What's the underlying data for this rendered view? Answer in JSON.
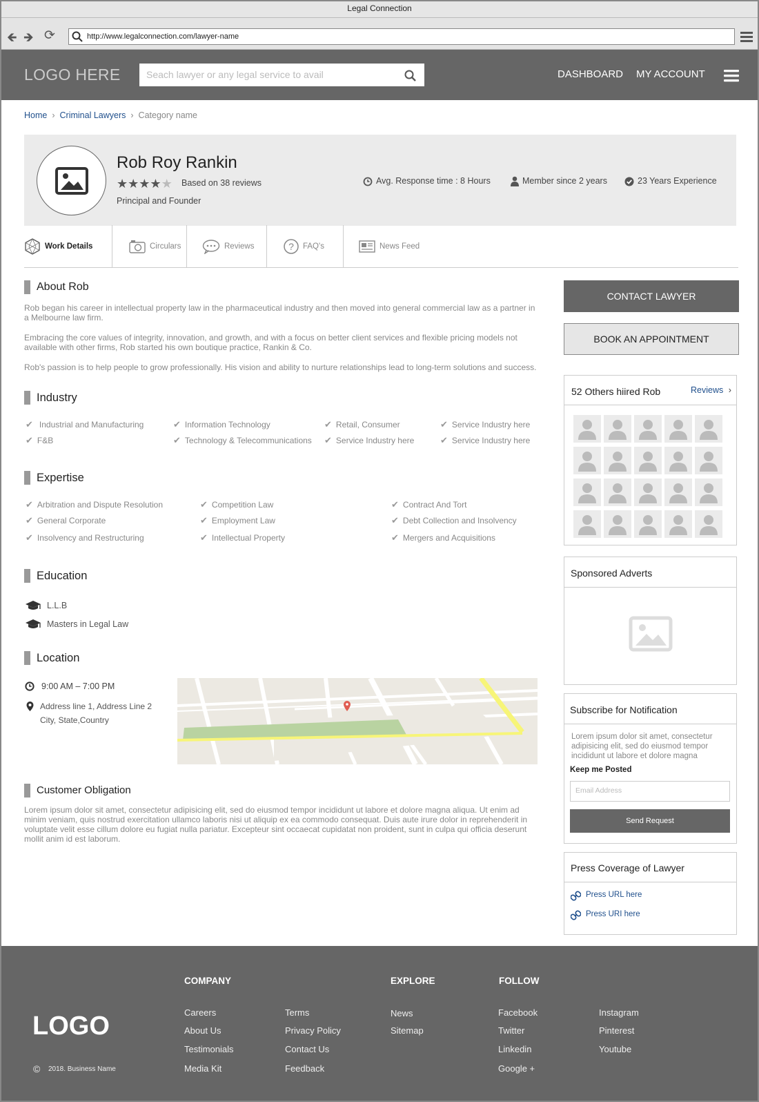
{
  "window": {
    "title": "Legal Connection",
    "url": "http://www.legalconnection.com/lawyer-name"
  },
  "header": {
    "logo": "LOGO HERE",
    "search_placeholder": "Seach lawyer or any legal service to avail",
    "nav": [
      "DASHBOARD",
      "MY ACCOUNT"
    ]
  },
  "breadcrumb": {
    "home": "Home",
    "category": "Criminal Lawyers",
    "current": "Category name"
  },
  "profile": {
    "name": "Rob Roy Rankin",
    "rating": 4,
    "rating_max": 5,
    "reviews_text": "Based on 38 reviews",
    "role": "Principal and Founder",
    "stats": {
      "response": "Avg. Response time : 8 Hours",
      "member": "Member since 2 years",
      "experience": "23 Years Experience"
    }
  },
  "tabs": [
    "Work Details",
    "Circulars",
    "Reviews",
    "FAQ's",
    "News Feed"
  ],
  "about": {
    "heading": "About Rob",
    "paragraphs": [
      "Rob began his career in intellectual property law in the pharmaceutical industry and then moved into general commercial law as a partner in a Melbourne law firm.",
      "Embracing the core values of integrity, innovation, and growth, and with a focus on better client services and flexible pricing models not available with other firms, Rob started his own boutique practice, Rankin & Co.",
      "Rob's passion is to help people to grow professionally. His vision and ability to nurture relationships lead to long-term solutions and success."
    ]
  },
  "industry": {
    "heading": "Industry",
    "items": [
      "Industrial and Manufacturing",
      "Information Technology",
      "Retail, Consumer",
      "Service Industry here",
      "F&B",
      "Technology & Telecommunications",
      "Service Industry here",
      "Service Industry here"
    ]
  },
  "expertise": {
    "heading": "Expertise",
    "items": [
      "Arbitration and Dispute Resolution",
      "Competition Law",
      "Contract And Tort",
      "General Corporate",
      "Employment Law",
      "Debt Collection and Insolvency",
      "Insolvency and Restructuring",
      "Intellectual Property",
      "Mergers and Acquisitions"
    ]
  },
  "education": {
    "heading": "Education",
    "items": [
      "L.L.B",
      "Masters in Legal Law"
    ]
  },
  "location": {
    "heading": "Location",
    "hours": "9:00 AM – 7:00 PM",
    "address1": "Address line 1, Address Line 2",
    "address2": "City, State,Country"
  },
  "obligation": {
    "heading": "Customer Obligation",
    "text": "Lorem ipsum dolor sit amet, consectetur adipisicing elit, sed do eiusmod tempor incididunt ut labore et dolore magna aliqua. Ut enim ad minim veniam, quis nostrud exercitation ullamco laboris nisi ut aliquip ex ea commodo consequat. Duis aute irure dolor in reprehenderit in voluptate velit esse cillum dolore eu fugiat nulla pariatur. Excepteur sint occaecat cupidatat non proident, sunt in culpa qui officia deserunt mollit anim id est laborum."
  },
  "sidebar": {
    "contact": "CONTACT LAWYER",
    "book": "BOOK AN APPOINTMENT",
    "hired": {
      "title": "52 Others hiired Rob",
      "link": "Reviews"
    },
    "sponsored": "Sponsored Adverts",
    "subscribe": {
      "title": "Subscribe for Notification",
      "text": "Lorem ipsum dolor sit amet, consectetur adipisicing elit, sed do eiusmod tempor incididunt ut labore et dolore magna",
      "label": "Keep me Posted",
      "placeholder": "Email Address",
      "button": "Send Request"
    },
    "press": {
      "title": "Press Coverage of Lawyer",
      "links": [
        "Press URL here",
        "Press URI here"
      ]
    }
  },
  "footer": {
    "logo": "LOGO",
    "copyright": "2018. Business Name",
    "company": {
      "heading": "COMPANY",
      "col1": [
        "Careers",
        "About Us",
        "Testimonials",
        "Media Kit"
      ],
      "col2": [
        "Terms",
        "Privacy Policy",
        "Contact Us",
        "Feedback"
      ]
    },
    "explore": {
      "heading": "EXPLORE",
      "items": [
        "News",
        "Sitemap"
      ]
    },
    "follow": {
      "heading": "FOLLOW",
      "col1": [
        "Facebook",
        "Twitter",
        "Linkedin",
        "Google +"
      ],
      "col2": [
        "Instagram",
        "Pinterest",
        "Youtube"
      ]
    }
  }
}
